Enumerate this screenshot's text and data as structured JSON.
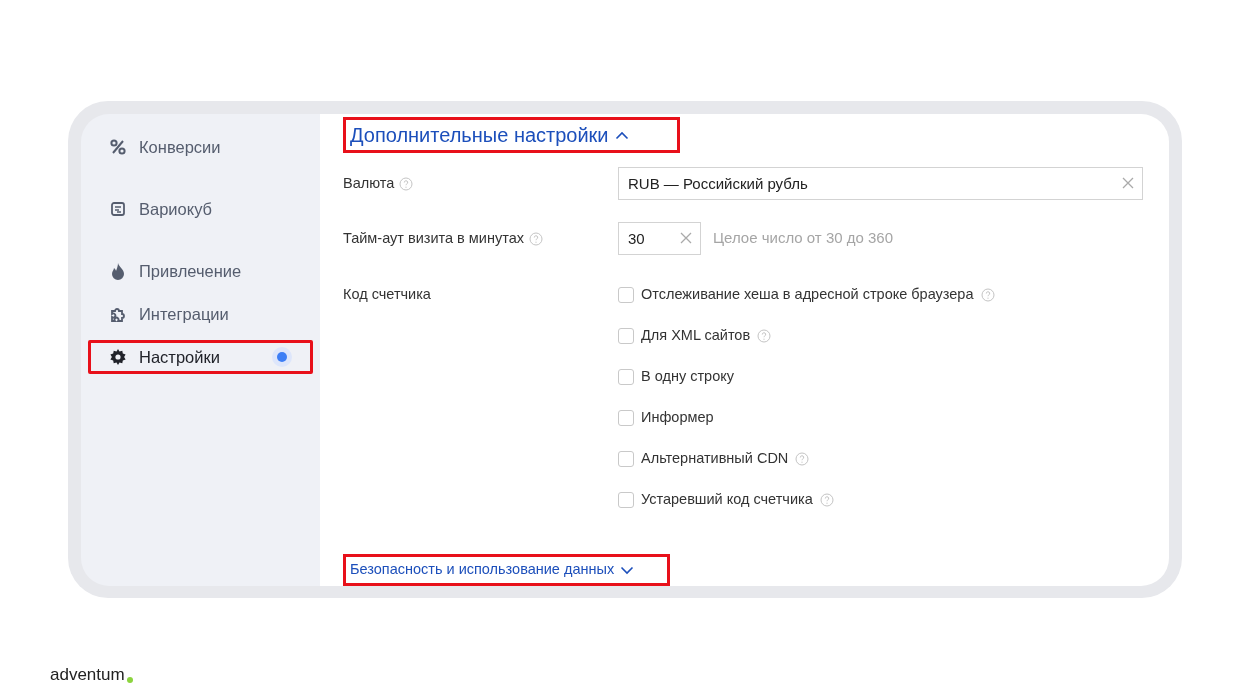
{
  "sidebar": {
    "items": [
      {
        "label": "Конверсии",
        "selected": false,
        "highlighted": false,
        "indicator": false
      },
      {
        "label": "Вариокуб",
        "selected": false,
        "highlighted": false,
        "indicator": false
      },
      {
        "label": "Привлечение",
        "selected": false,
        "highlighted": false,
        "indicator": false
      },
      {
        "label": "Интеграции",
        "selected": false,
        "highlighted": false,
        "indicator": false
      },
      {
        "label": "Настройки",
        "selected": true,
        "highlighted": true,
        "indicator": true
      }
    ]
  },
  "advanced": {
    "title": "Дополнительные настройки",
    "expanded": true,
    "highlighted": true,
    "currency": {
      "label": "Валюта",
      "value": "RUB — Российский рубль"
    },
    "timeout": {
      "label": "Тайм-аут визита в минутах",
      "value": "30",
      "hint": "Целое число от 30 до 360"
    },
    "counter_code": {
      "label": "Код счетчика",
      "options": [
        {
          "label": "Отслеживание хеша в адресной строке браузера",
          "checked": false,
          "help": true
        },
        {
          "label": "Для XML сайтов",
          "checked": false,
          "help": true
        },
        {
          "label": "В одну строку",
          "checked": false,
          "help": false
        },
        {
          "label": "Информер",
          "checked": false,
          "help": false
        },
        {
          "label": "Альтернативный CDN",
          "checked": false,
          "help": true
        },
        {
          "label": "Устаревший код счетчика",
          "checked": false,
          "help": true
        }
      ]
    }
  },
  "security": {
    "title": "Безопасность и использование данных",
    "expanded": false,
    "highlighted": true
  },
  "footer_logo": "adventum"
}
